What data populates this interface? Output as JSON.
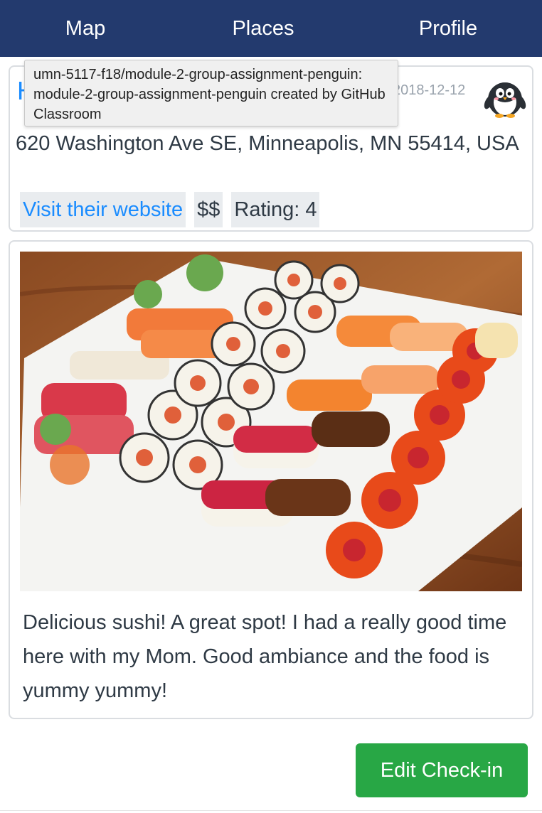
{
  "nav": {
    "map": "Map",
    "places": "Places",
    "profile": "Profile"
  },
  "place": {
    "title": "H",
    "date": "2018-12-12",
    "address": "620 Washington Ave SE, Minneapolis, MN 55414, USA",
    "website_label": "Visit their website",
    "price": "$$",
    "rating": "Rating: 4",
    "avatar_icon": "penguin-icon"
  },
  "tooltip": {
    "text": "umn-5117-f18/module-2-group-assignment-penguin: module-2-group-assignment-penguin created by GitHub Classroom"
  },
  "checkin": {
    "photo_icon": "sushi-platter-photo",
    "review": "Delicious sushi! A great spot! I had a really good time here with my Mom. Good ambiance and the food is yummy yummy!"
  },
  "actions": {
    "edit_label": "Edit Check-in"
  },
  "colors": {
    "navbar": "#233a6e",
    "link": "#1a8cff",
    "button": "#28a745"
  }
}
